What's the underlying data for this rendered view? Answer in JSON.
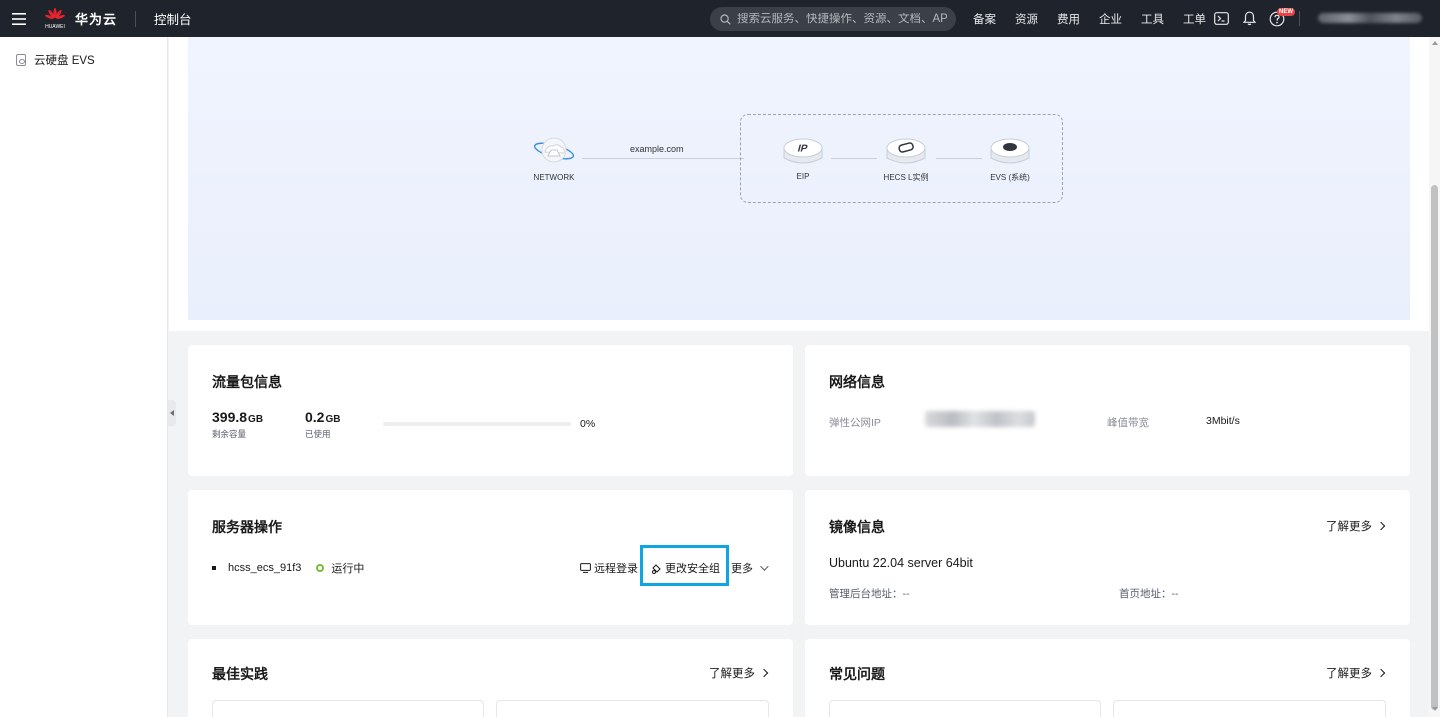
{
  "header": {
    "brand": "华为云",
    "logo_caption": "HUAWEI",
    "console": "控制台",
    "search_placeholder": "搜索云服务、快捷操作、资源、文档、API",
    "nav": [
      "备案",
      "资源",
      "费用",
      "企业",
      "工具",
      "工单"
    ],
    "new_badge": "NEW"
  },
  "sidebar": {
    "items": [
      {
        "label": "云硬盘 EVS",
        "icon": "disk-icon"
      }
    ]
  },
  "topology": {
    "domain": "example.com",
    "nodes": {
      "network": "NETWORK",
      "eip": "EIP",
      "hecs": "HECS L实例",
      "evs": "EVS (系统)"
    }
  },
  "traffic": {
    "title": "流量包信息",
    "remaining_value": "399.8",
    "remaining_unit": "GB",
    "remaining_caption": "剩余容量",
    "used_value": "0.2",
    "used_unit": "GB",
    "used_caption": "已使用",
    "used_percent_text": "0%",
    "used_fraction": 0.0
  },
  "network": {
    "title": "网络信息",
    "eip_label": "弹性公网IP",
    "bandwidth_label": "峰值带宽",
    "bandwidth_value": "3Mbit/s"
  },
  "server": {
    "title": "服务器操作",
    "name": "hcss_ecs_91f3",
    "status": "运行中",
    "remote_login": "远程登录",
    "change_sg": "更改安全组",
    "more": "更多"
  },
  "image": {
    "title": "镜像信息",
    "more": "了解更多",
    "os": "Ubuntu 22.04 server 64bit",
    "admin_label": "管理后台地址：",
    "admin_value": "--",
    "home_label": "首页地址：",
    "home_value": "--"
  },
  "best": {
    "title": "最佳实践",
    "more": "了解更多"
  },
  "faq": {
    "title": "常见问题",
    "more": "了解更多"
  },
  "colors": {
    "topbar": "#1f232b",
    "highlight": "#0ea5e0",
    "running": "#7bbb3c"
  }
}
